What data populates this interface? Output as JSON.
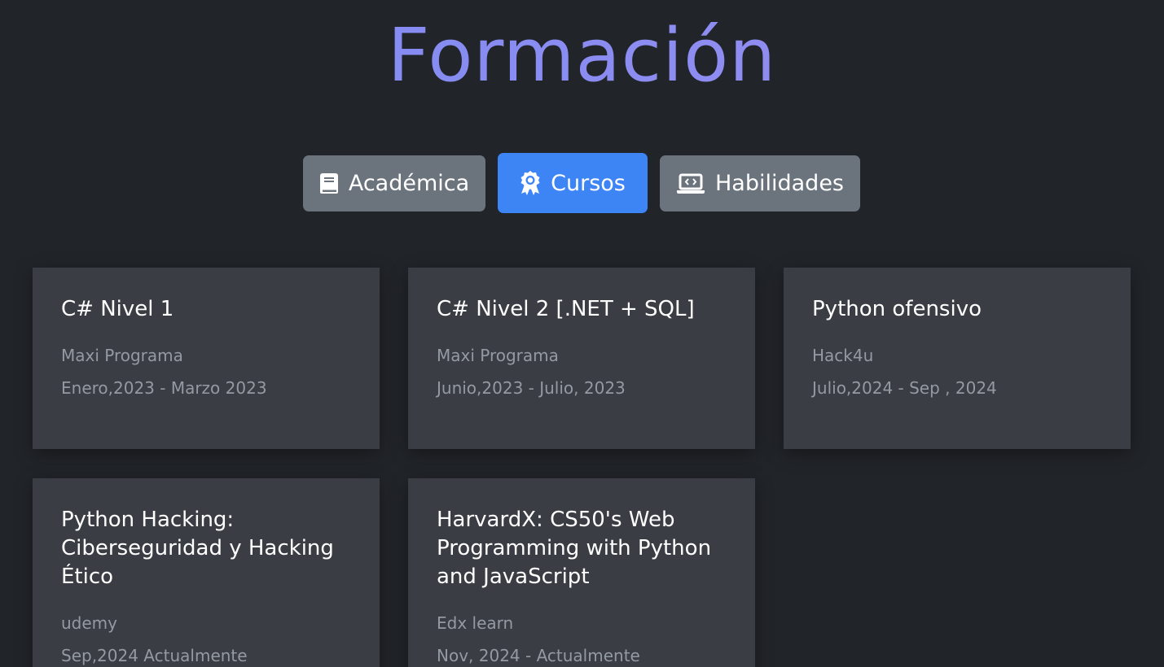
{
  "header": {
    "title": "Formación"
  },
  "tabs": [
    {
      "label": "Académica",
      "icon": "book-icon",
      "active": false
    },
    {
      "label": "Cursos",
      "icon": "award-ribbon-icon",
      "active": true
    },
    {
      "label": "Habilidades",
      "icon": "laptop-code-icon",
      "active": false
    }
  ],
  "colors": {
    "background": "#212429",
    "card": "#3a3d43",
    "tab_inactive": "#6b737d",
    "tab_active": "#3d84f5",
    "title_gradient_start": "#7b8cf2",
    "title_gradient_end": "#9a8df0",
    "muted_text": "#949aa2"
  },
  "courses": [
    {
      "title": "C# Nivel 1",
      "institution": "Maxi Programa",
      "dates": "Enero,2023 - Marzo 2023"
    },
    {
      "title": "C# Nivel 2 [.NET + SQL]",
      "institution": "Maxi Programa",
      "dates": "Junio,2023 - Julio, 2023"
    },
    {
      "title": "Python ofensivo",
      "institution": "Hack4u",
      "dates": "Julio,2024 - Sep , 2024"
    },
    {
      "title": "Python Hacking: Ciberseguridad y Hacking Ético",
      "institution": "udemy",
      "dates": "Sep,2024 Actualmente"
    },
    {
      "title": "HarvardX: CS50's Web Programming with Python and JavaScript",
      "institution": "Edx learn",
      "dates": "Nov, 2024 - Actualmente"
    }
  ]
}
